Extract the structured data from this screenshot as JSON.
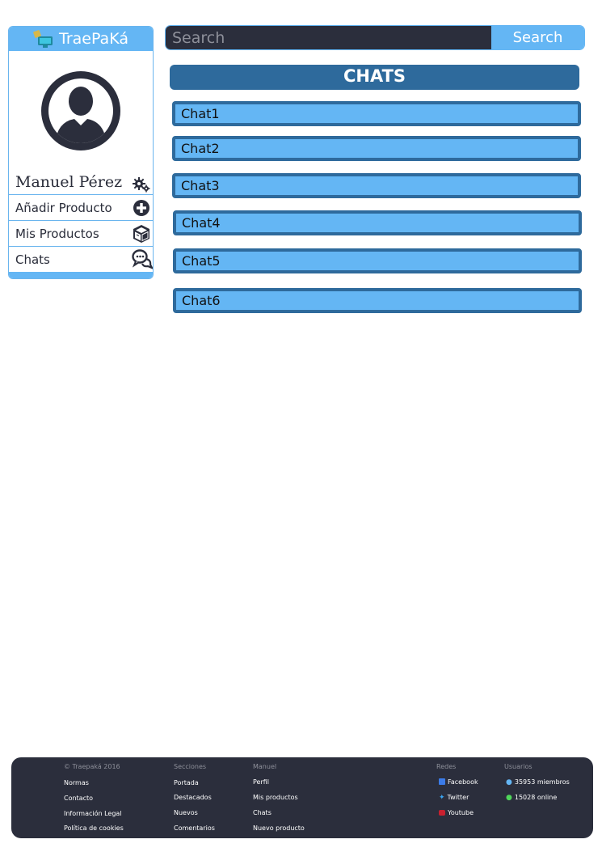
{
  "brand": {
    "name": "TraePaKá"
  },
  "search": {
    "placeholder": "Search",
    "button_label": "Search"
  },
  "sidebar": {
    "user_name": "Manuel Pérez",
    "items": [
      {
        "label": "Añadir Producto",
        "icon": "plus-circle-icon"
      },
      {
        "label": "Mis Productos",
        "icon": "package-icon"
      },
      {
        "label": "Chats",
        "icon": "chat-bubbles-icon"
      }
    ]
  },
  "main": {
    "title": "CHATS",
    "chats": [
      "Chat1",
      "Chat2",
      "Chat3",
      "Chat4",
      "Chat5",
      "Chat6"
    ]
  },
  "footer": {
    "col1": {
      "heading": "© Traepaká 2016",
      "links": [
        "Normas",
        "Contacto",
        "Información Legal",
        "Política de cookies"
      ]
    },
    "col2": {
      "heading": "Secciones",
      "links": [
        "Portada",
        "Destacados",
        "Nuevos",
        "Comentarios"
      ]
    },
    "col3": {
      "heading": "Manuel",
      "links": [
        "Perfil",
        "Mis productos",
        "Chats",
        "Nuevo producto"
      ]
    },
    "col4": {
      "heading": "Redes",
      "links": [
        "Facebook",
        "Twitter",
        "Youtube"
      ]
    },
    "col5": {
      "heading": "Usuarios",
      "members": "35953 miembros",
      "online": "15028 online"
    }
  },
  "colors": {
    "accent": "#64b6f4",
    "dark": "#2b2e3c",
    "header_blue": "#2e6a9c"
  }
}
